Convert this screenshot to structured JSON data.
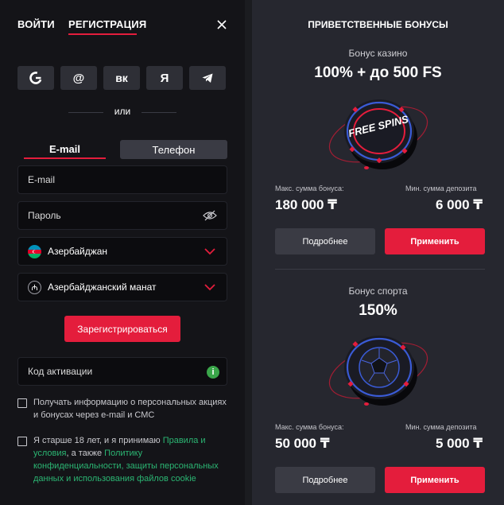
{
  "header": {
    "login_tab": "ВОЙТИ",
    "register_tab": "РЕГИСТРАЦИЯ"
  },
  "social": [
    {
      "icon": "google-icon",
      "glyph": "G"
    },
    {
      "icon": "mail-icon",
      "glyph": "@"
    },
    {
      "icon": "vk-icon",
      "glyph": "вк"
    },
    {
      "icon": "yandex-icon",
      "glyph": "Я"
    },
    {
      "icon": "telegram-icon",
      "glyph": "➤"
    }
  ],
  "divider_text": "или",
  "method_tabs": {
    "email": "E-mail",
    "phone": "Телефон"
  },
  "form": {
    "email_placeholder": "E-mail",
    "password_placeholder": "Пароль",
    "country": "Азербайджан",
    "currency": "Азербайджанский манат",
    "submit": "Зарегистрироваться",
    "promo_placeholder": "Код активации"
  },
  "consent": {
    "marketing": "Получать информацию о персональных акциях и бонусах через e-mail и СМС",
    "age_prefix": "Я старше 18 лет, и я принимаю ",
    "rules_link": "Правила и условия",
    "age_mid": ", а также ",
    "policy_link": "Политику конфиденциальности, защиты персональных данных и использования файлов cookie"
  },
  "bonuses": {
    "title": "ПРИВЕТСТВЕННЫЕ БОНУСЫ",
    "casino": {
      "subtitle": "Бонус казино",
      "headline": "100% + до 500 FS",
      "chip_text": "FREE SPINS",
      "max_label": "Макс. сумма бонуса:",
      "max_value": "180 000 ₸",
      "min_label": "Мин. сумма депозита",
      "min_value": "6 000 ₸",
      "more": "Подробнее",
      "apply": "Применить"
    },
    "sport": {
      "subtitle": "Бонус спорта",
      "headline": "150%",
      "max_label": "Макс. сумма бонуса:",
      "max_value": "50 000 ₸",
      "min_label": "Мин. сумма депозита",
      "min_value": "5 000 ₸",
      "more": "Подробнее",
      "apply": "Применить"
    }
  },
  "colors": {
    "accent": "#e41d3c",
    "link": "#2bb673",
    "panel": "#26272f",
    "left_bg": "#141418"
  }
}
